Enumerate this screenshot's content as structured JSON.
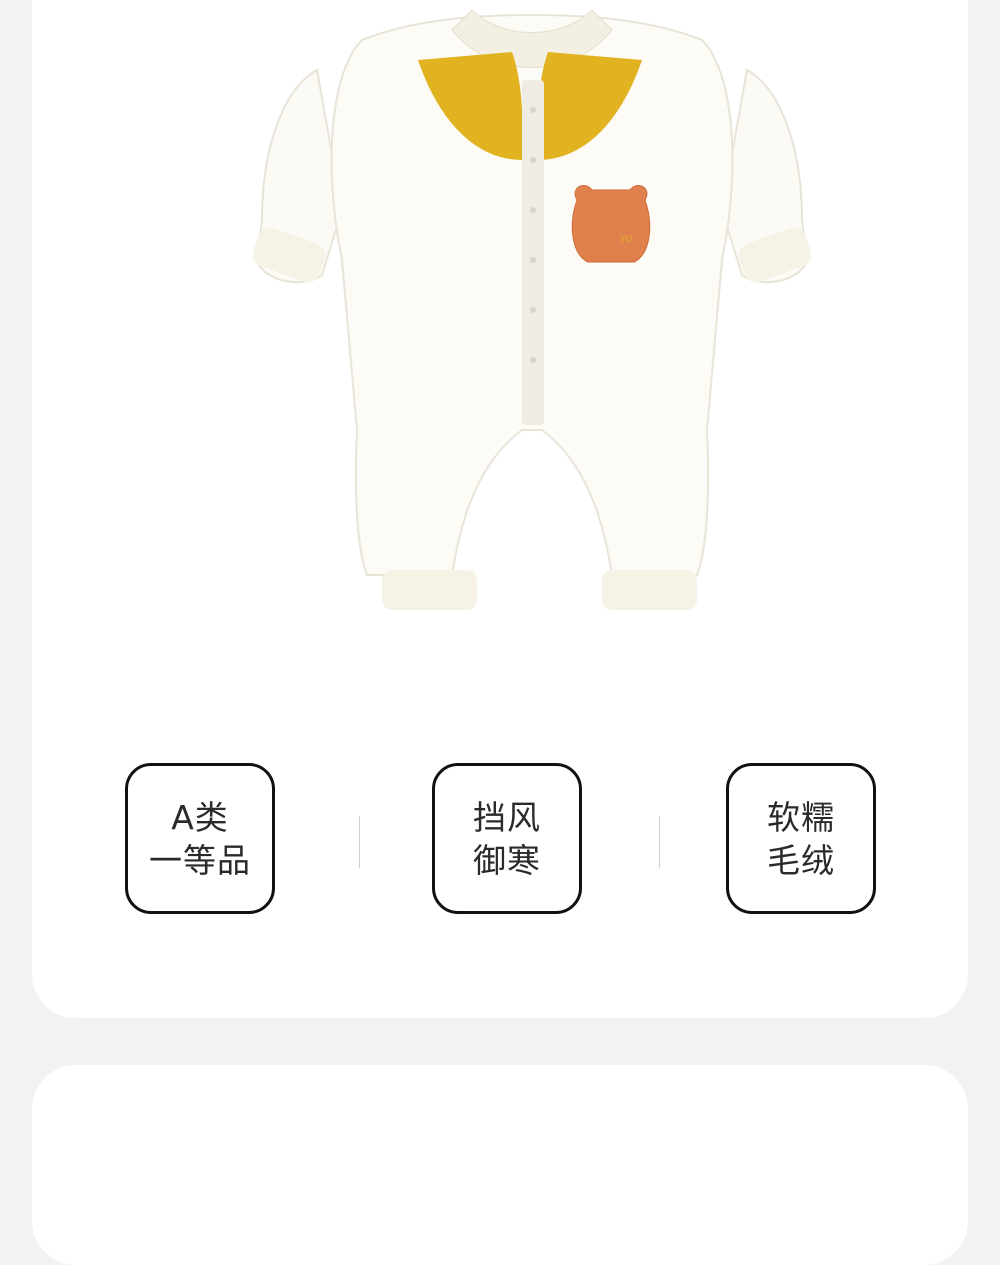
{
  "product": {
    "image_desc_icon": "baby-romper-image"
  },
  "features": [
    {
      "line1": "A类",
      "line2": "一等品"
    },
    {
      "line1": "挡风",
      "line2": "御寒"
    },
    {
      "line1": "软糯",
      "line2": "毛绒"
    }
  ],
  "colors": {
    "page_bg": "#f2f2f2",
    "card_bg": "#ffffff",
    "border": "#111111",
    "text": "#2a2a2a",
    "yoke_yellow": "#e2b321",
    "pocket_orange": "#e0804c"
  }
}
